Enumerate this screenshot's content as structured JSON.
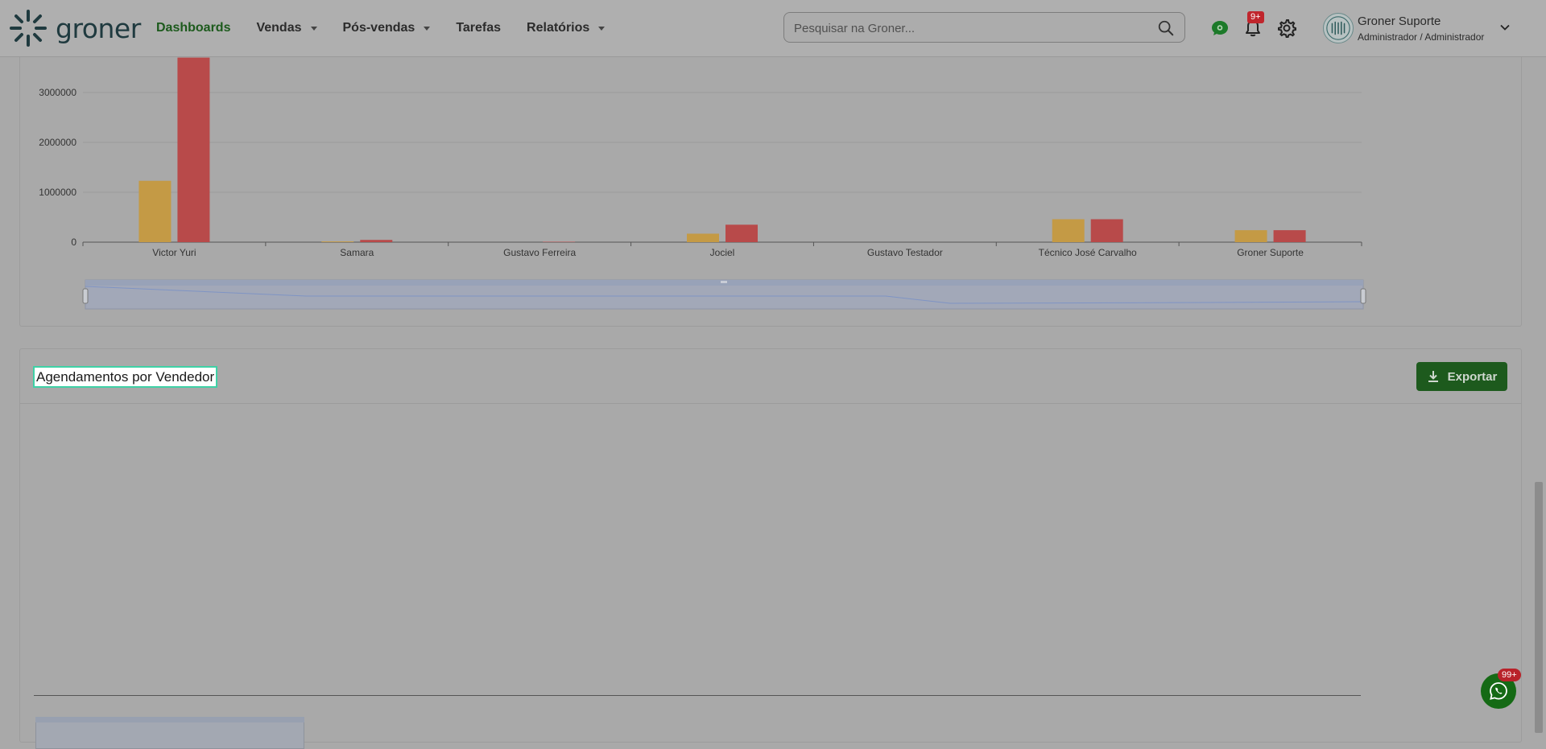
{
  "app": {
    "logo_text": "groner",
    "nav": [
      {
        "label": "Dashboards",
        "active": true,
        "dropdown": false
      },
      {
        "label": "Vendas",
        "active": false,
        "dropdown": true
      },
      {
        "label": "Pós-vendas",
        "active": false,
        "dropdown": true
      },
      {
        "label": "Tarefas",
        "active": false,
        "dropdown": false
      },
      {
        "label": "Relatórios",
        "active": false,
        "dropdown": true
      }
    ],
    "search": {
      "placeholder": "Pesquisar na Groner..."
    },
    "notifications_badge": "9+",
    "user": {
      "name": "Groner Suporte",
      "role": "Administrador / Administrador"
    },
    "whatsapp_badge": "99+"
  },
  "colors": {
    "accent": "#1c5a1c",
    "bar_series_a": "#c49a45",
    "bar_series_b": "#b84a4a"
  },
  "panels": {
    "agendamentos": {
      "title": "Agendamentos por Vendedor",
      "export_label": "Exportar"
    }
  },
  "chart_data": {
    "type": "bar",
    "categories": [
      "Victor Yuri",
      "Samara",
      "Gustavo Ferreira",
      "Jociel",
      "Gustavo Testador",
      "Técnico José Carvalho",
      "Groner Suporte"
    ],
    "series": [
      {
        "values": [
          1230000,
          15000,
          0,
          170000,
          0,
          460000,
          240000
        ]
      },
      {
        "values": [
          3700000,
          45000,
          8000,
          350000,
          0,
          460000,
          240000
        ]
      }
    ],
    "yticks": [
      0,
      1000000,
      2000000,
      3000000
    ],
    "ylim": [
      0,
      3000000
    ],
    "grid": true,
    "data_zoom": true
  }
}
